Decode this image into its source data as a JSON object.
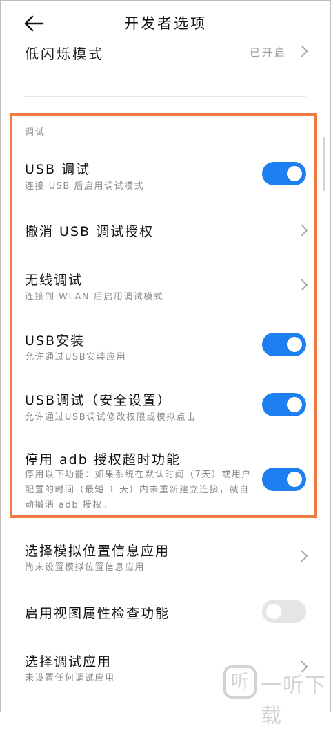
{
  "header": {
    "title": "开发者选项",
    "back_icon": "arrow-left-icon"
  },
  "prev_item": {
    "label": "低闪烁模式",
    "value": "已开启"
  },
  "debug_section": {
    "title": "调试",
    "items": [
      {
        "label": "USB 调试",
        "sub": "连接 USB 后启用调试模式",
        "toggle": true
      },
      {
        "label": "撤消 USB 调试授权",
        "sub": "",
        "chevron": true
      },
      {
        "label": "无线调试",
        "sub": "连接到 WLAN 后启用调试模式",
        "chevron": true
      },
      {
        "label": "USB安装",
        "sub": "允许通过USB安装应用",
        "toggle": true
      },
      {
        "label": "USB调试（安全设置）",
        "sub": "允许通过USB调试修改权限或模拟点击",
        "toggle": true
      },
      {
        "label": "停用 adb 授权超时功能",
        "sub": "停用以下功能：如果系统在默认时间（7天）或用户配置的时间（最短 1 天）内未重新建立连接，就自动撤消 adb 授权。",
        "toggle": true
      }
    ]
  },
  "more_items": [
    {
      "label": "选择模拟位置信息应用",
      "sub": "尚未设置模拟位置信息应用",
      "chevron": true
    },
    {
      "label": "启用视图属性检查功能",
      "toggle": false
    },
    {
      "label": "选择调试应用",
      "sub": "未设置任何调试应用",
      "chevron": true
    }
  ],
  "watermark": {
    "text": "一听下载",
    "icon_glyph": "听"
  },
  "colors": {
    "accent": "#1e7ff0",
    "highlight": "#f07b41"
  }
}
